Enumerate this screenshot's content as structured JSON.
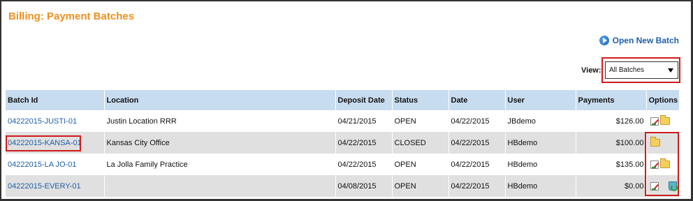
{
  "page": {
    "title": "Billing: Payment Batches",
    "open_batch_label": "Open New Batch",
    "view_label": "View:",
    "view_selected": "All Batches"
  },
  "columns": [
    "Batch Id",
    "Location",
    "Deposit Date",
    "Status",
    "Date",
    "User",
    "Payments",
    "Options"
  ],
  "rows": [
    {
      "batch_id": "04222015-JUSTI-01",
      "location": "Justin Location RRR",
      "deposit_date": "04/21/2015",
      "status": "OPEN",
      "date": "04/22/2015",
      "user": "JBdemo",
      "payments": "$126.00",
      "options": [
        "edit-icon",
        "folder-icon"
      ]
    },
    {
      "batch_id": "04222015-KANSA-01",
      "location": "Kansas City Office",
      "deposit_date": "04/22/2015",
      "status": "CLOSED",
      "date": "04/22/2015",
      "user": "HBdemo",
      "payments": "$100.00",
      "options": [
        "folder-icon"
      ]
    },
    {
      "batch_id": "04222015-LA JO-01",
      "location": "La Jolla Family Practice",
      "deposit_date": "04/22/2015",
      "status": "OPEN",
      "date": "04/22/2015",
      "user": "HBdemo",
      "payments": "$135.00",
      "options": [
        "edit-icon",
        "folder-icon"
      ]
    },
    {
      "batch_id": "04222015-EVERY-01",
      "location": "",
      "deposit_date": "04/08/2015",
      "status": "OPEN",
      "date": "04/22/2015",
      "user": "HBdemo",
      "payments": "$0.00",
      "options": [
        "edit-icon",
        "trash-icon"
      ]
    }
  ],
  "colors": {
    "title": "#f0901e",
    "header_bg": "#c8dcf0",
    "alt_row_bg": "#e0e0e0",
    "link": "#1f5fa8",
    "highlight": "#d01a1a"
  }
}
